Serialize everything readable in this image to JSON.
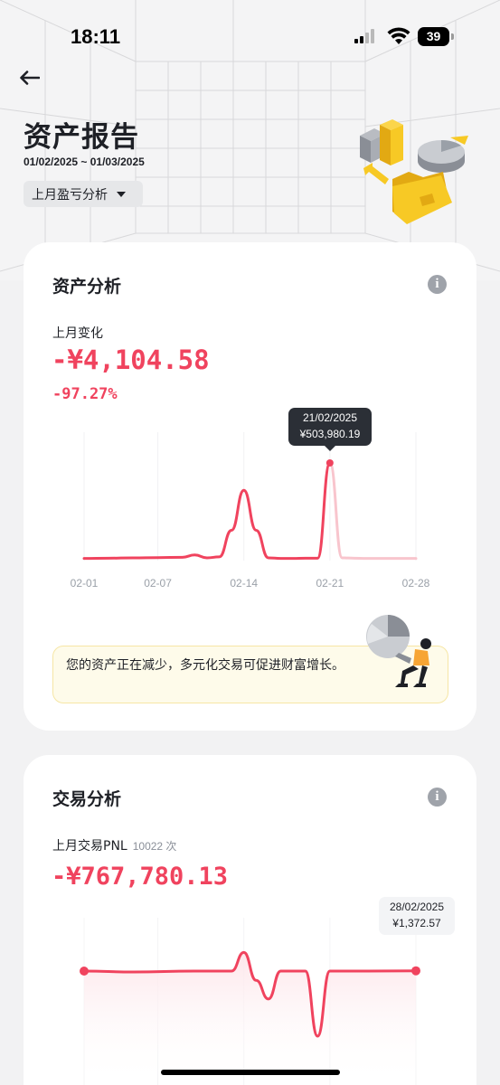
{
  "status_bar": {
    "time": "18:11",
    "battery": "39"
  },
  "header": {
    "title": "资产报告",
    "date_range": "01/02/2025 ~ 01/03/2025",
    "period_select": "上月盈亏分析"
  },
  "asset_card": {
    "title": "资产分析",
    "change_label": "上月变化",
    "change_amount": "-¥4,104.58",
    "change_pct": "-97.27%",
    "tooltip_date": "21/02/2025",
    "tooltip_value": "¥503,980.19",
    "tip_text": "您的资产正在减少，多元化交易可促进财富增长。"
  },
  "trade_card": {
    "title": "交易分析",
    "label": "上月交易PNL",
    "count": "10022 次",
    "amount": "-¥767,780.13",
    "tooltip_date": "28/02/2025",
    "tooltip_value": "¥1,372.57"
  },
  "colors": {
    "loss": "#f0435e",
    "accent_yellow": "#f7c925"
  },
  "chart_data": [
    {
      "type": "line",
      "title": "",
      "x_ticks": [
        "02-01",
        "02-07",
        "02-14",
        "02-21",
        "02-28"
      ],
      "highlight": {
        "x": "21/02/2025",
        "y": 503980.19
      },
      "series": [
        {
          "x": [
            "02-01",
            "02-03",
            "02-05",
            "02-07",
            "02-09",
            "02-10",
            "02-11",
            "02-12",
            "02-13",
            "02-14",
            "02-15",
            "02-16",
            "02-17",
            "02-18",
            "02-19",
            "02-20",
            "02-21",
            "02-22",
            "02-23",
            "02-24",
            "02-26",
            "02-28"
          ],
          "y": [
            2000,
            3000,
            5000,
            6000,
            8000,
            20000,
            5000,
            10000,
            150000,
            360000,
            150000,
            5000,
            2000,
            2000,
            3000,
            3000,
            503980.19,
            5000,
            3000,
            2000,
            2000,
            1500
          ]
        }
      ]
    },
    {
      "type": "line",
      "title": "",
      "highlight": {
        "x": "28/02/2025",
        "y": 1372.57
      },
      "series": [
        {
          "x": [
            "02-01",
            "02-05",
            "02-10",
            "02-13",
            "02-14",
            "02-15",
            "02-16",
            "02-17",
            "02-18",
            "02-19",
            "02-20",
            "02-21",
            "02-22",
            "02-24",
            "02-28"
          ],
          "y": [
            0,
            -5000,
            0,
            0,
            100000,
            -50000,
            -150000,
            0,
            0,
            0,
            -350000,
            0,
            0,
            0,
            1372.57
          ]
        }
      ]
    }
  ]
}
